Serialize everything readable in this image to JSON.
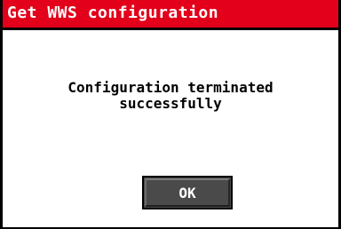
{
  "dialog": {
    "title": "Get WWS configuration",
    "message_line1": "Configuration terminated",
    "message_line2": "successfully",
    "ok_label": "OK"
  },
  "colors": {
    "title_bar": "#e2001a",
    "title_text": "#ffffff",
    "button_face": "#4a4a4a",
    "button_text": "#ffffff",
    "background": "#ffffff"
  }
}
